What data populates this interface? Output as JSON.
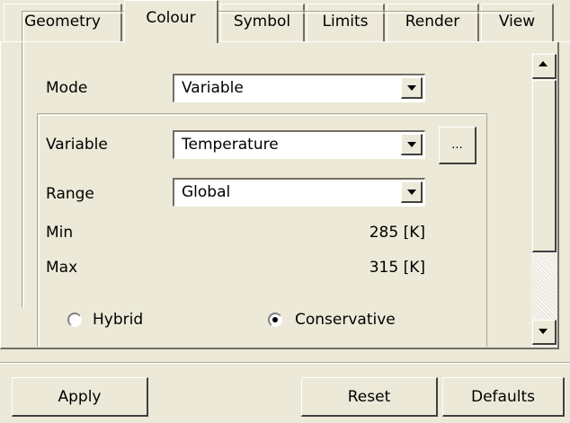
{
  "tabs": [
    {
      "label": "Geometry",
      "active": false
    },
    {
      "label": "Colour",
      "active": true
    },
    {
      "label": "Symbol",
      "active": false
    },
    {
      "label": "Limits",
      "active": false
    },
    {
      "label": "Render",
      "active": false
    },
    {
      "label": "View",
      "active": false
    }
  ],
  "colour": {
    "mode_label": "Mode",
    "mode_value": "Variable",
    "variable_label": "Variable",
    "variable_value": "Temperature",
    "browse_label": "...",
    "range_label": "Range",
    "range_value": "Global",
    "min_label": "Min",
    "min_value": "285 [K]",
    "max_label": "Max",
    "max_value": "315 [K]",
    "radio_hybrid": {
      "label": "Hybrid",
      "checked": false
    },
    "radio_conservative": {
      "label": "Conservative",
      "checked": true
    }
  },
  "buttons": {
    "apply": "Apply",
    "reset": "Reset",
    "defaults": "Defaults"
  },
  "icons": {
    "dropdown": "chevron-down-icon",
    "scroll_up": "arrow-up-icon",
    "scroll_down": "arrow-down-icon"
  }
}
